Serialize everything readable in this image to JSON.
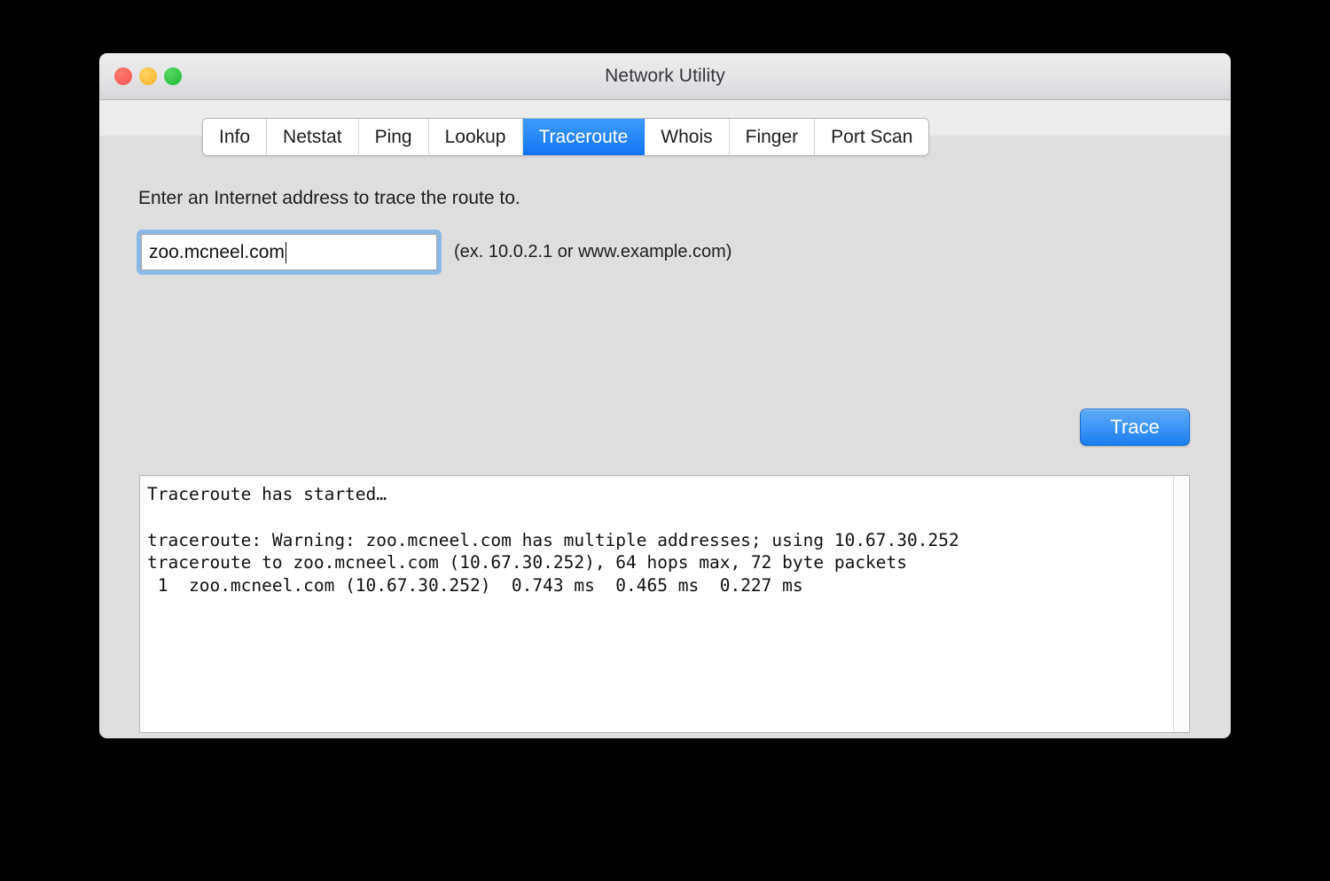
{
  "window": {
    "title": "Network Utility",
    "traffic_lights": [
      {
        "name": "close",
        "color": "#f4544c"
      },
      {
        "name": "minimize",
        "color": "#f7b324"
      },
      {
        "name": "zoom",
        "color": "#1fb934"
      }
    ]
  },
  "tabs": [
    {
      "label": "Info",
      "selected": false
    },
    {
      "label": "Netstat",
      "selected": false
    },
    {
      "label": "Ping",
      "selected": false
    },
    {
      "label": "Lookup",
      "selected": false
    },
    {
      "label": "Traceroute",
      "selected": true
    },
    {
      "label": "Whois",
      "selected": false
    },
    {
      "label": "Finger",
      "selected": false
    },
    {
      "label": "Port Scan",
      "selected": false
    }
  ],
  "traceroute": {
    "prompt": "Enter an Internet address to trace the route to.",
    "address_value": "zoo.mcneel.com",
    "address_placeholder": "",
    "hint": "(ex. 10.0.2.1 or www.example.com)",
    "trace_button_label": "Trace",
    "output": "Traceroute has started…\n\ntraceroute: Warning: zoo.mcneel.com has multiple addresses; using 10.67.30.252\ntraceroute to zoo.mcneel.com (10.67.30.252), 64 hops max, 72 byte packets\n 1  zoo.mcneel.com (10.67.30.252)  0.743 ms  0.465 ms  0.227 ms"
  },
  "colors": {
    "accent_blue": "#1274f2",
    "focus_ring": "#8cb8e4",
    "window_bg": "#dedede",
    "titlebar_bg": "#e4e4e6"
  }
}
